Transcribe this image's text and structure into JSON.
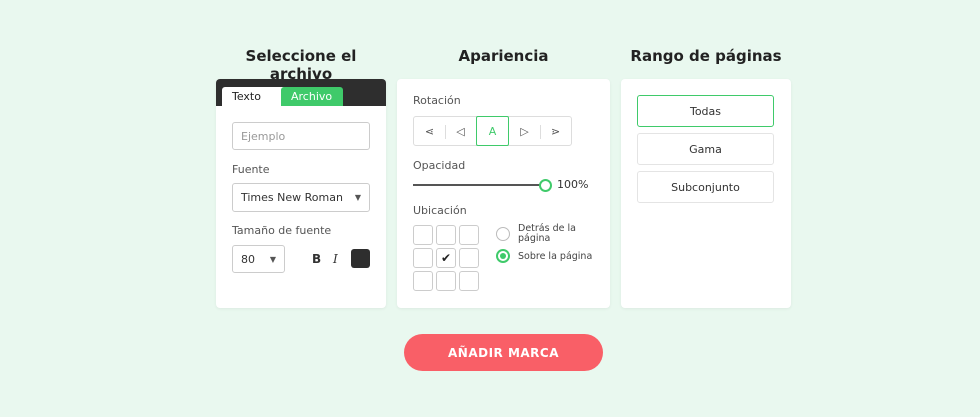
{
  "columns": {
    "file": {
      "title": "Seleccione el archivo"
    },
    "appearance": {
      "title": "Apariencia"
    },
    "pages": {
      "title": "Rango de páginas"
    }
  },
  "file_card": {
    "tabs": [
      "Texto",
      "Archivo"
    ],
    "text_input": {
      "placeholder": "Ejemplo",
      "value": ""
    },
    "font_label": "Fuente",
    "font_select_value": "Times New Roman",
    "size_label": "Tamaño de fuente",
    "size_select_value": "80",
    "bold_label": "B",
    "italic_label": "I",
    "color_swatch": "#2e2e2e"
  },
  "appearance_card": {
    "rotation_label": "Rotación",
    "rotation_options": [
      "⋖",
      "◁",
      "A",
      "◁",
      "⋗"
    ],
    "active_rotation_index": 2,
    "opacity_label": "Opacidad",
    "opacity_value": "100%",
    "location_label": "Ubicación",
    "grid_checked_cell": 4,
    "checkmark": "✔",
    "radio_behind": "Detrás de la página",
    "radio_over": "Sobre la página",
    "radio_selected": "over"
  },
  "pages_card": {
    "options": [
      "Todas",
      "Gama",
      "Subconjunto"
    ],
    "active_index": 0
  },
  "submit_label": "AÑADIR MARCA",
  "colors": {
    "accent_green": "#3fca6a",
    "submit_red": "#f95f67",
    "background": "#e9f8ef"
  }
}
